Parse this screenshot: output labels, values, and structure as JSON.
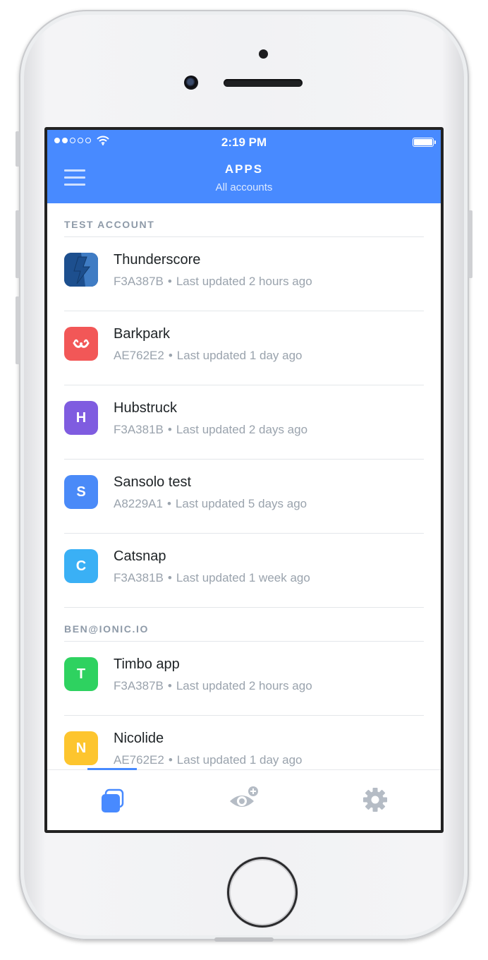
{
  "statusbar": {
    "time": "2:19 PM",
    "signal_bars_filled": 2,
    "signal_bars_total": 5,
    "wifi_icon": "wifi-icon",
    "battery_icon": "battery-icon"
  },
  "navbar": {
    "title": "APPS",
    "subtitle": "All accounts",
    "menu_icon": "hamburger-menu-icon",
    "background": "#488aff"
  },
  "sections": [
    {
      "title": "TEST ACCOUNT",
      "apps": [
        {
          "name": "Thunderscore",
          "id": "F3A387B",
          "updated": "Last updated 2 hours ago",
          "icon": "lightning-logo",
          "color": "#1d4f8e"
        },
        {
          "name": "Barkpark",
          "id": "AE762E2",
          "updated": "Last updated 1 day ago",
          "icon": "dog-face-logo",
          "color": "#f25757"
        },
        {
          "name": "Hubstruck",
          "id": "F3A381B",
          "updated": "Last updated 2 days ago",
          "letter": "H",
          "color": "#7f5ce0"
        },
        {
          "name": "Sansolo test",
          "id": "A8229A1",
          "updated": "Last updated 5 days ago",
          "letter": "S",
          "color": "#4a8af8"
        },
        {
          "name": "Catsnap",
          "id": "F3A381B",
          "updated": "Last updated 1 week ago",
          "letter": "C",
          "color": "#3ab0f5"
        }
      ]
    },
    {
      "title": "BEN@IONIC.IO",
      "apps": [
        {
          "name": "Timbo app",
          "id": "F3A387B",
          "updated": "Last updated 2 hours ago",
          "letter": "T",
          "color": "#2ed260"
        },
        {
          "name": "Nicolide",
          "id": "AE762E2",
          "updated": "Last updated 1 day ago",
          "letter": "N",
          "color": "#fdc52e"
        }
      ]
    }
  ],
  "separator": "•",
  "tabs": [
    {
      "icon": "apps-stack-icon",
      "active": true,
      "color": "#488aff"
    },
    {
      "icon": "eye-add-icon",
      "active": false,
      "color": "#b5bcc5"
    },
    {
      "icon": "gear-icon",
      "active": false,
      "color": "#b5bcc5"
    }
  ]
}
